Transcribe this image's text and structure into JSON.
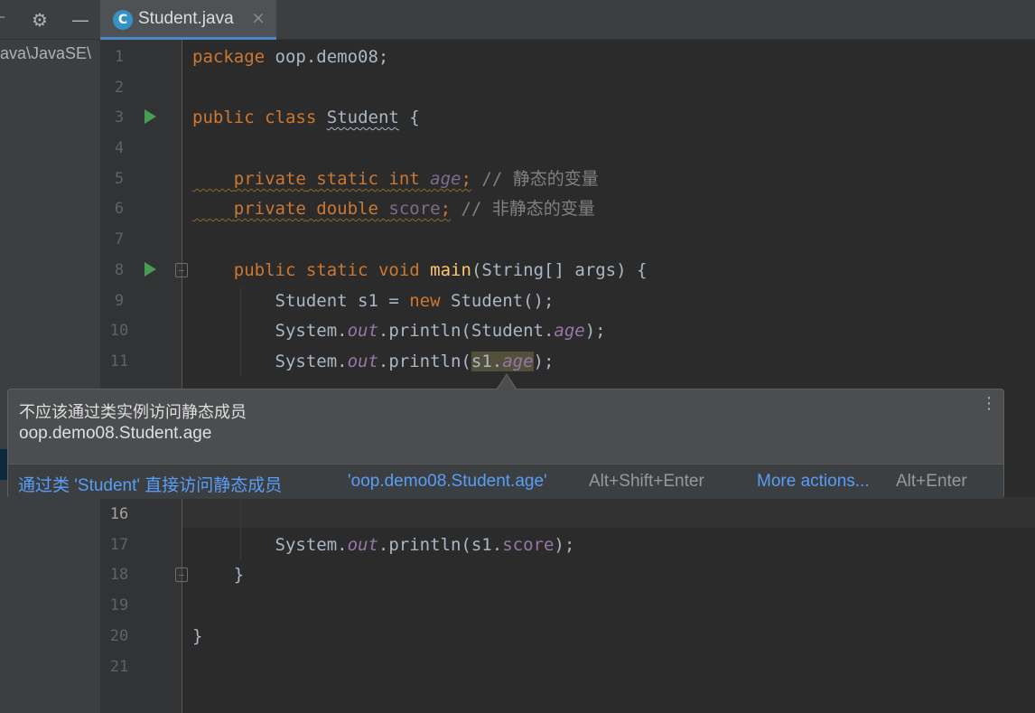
{
  "project": {
    "path_fragment": "ava\\JavaSE\\"
  },
  "toolbar": {
    "settings_icon": "gear-icon",
    "collapse_icon": "minus-icon"
  },
  "tab": {
    "icon_letter": "C",
    "label": "Student.java",
    "close": "×"
  },
  "editor": {
    "current_line": 16,
    "line_numbers": [
      "1",
      "2",
      "3",
      "4",
      "5",
      "6",
      "7",
      "8",
      "9",
      "10",
      "11",
      "16",
      "17",
      "18",
      "19",
      "20",
      "21"
    ],
    "lines": {
      "l1": {
        "kw": "package",
        "rest": " oop.demo08;"
      },
      "l3": {
        "kw1": "public",
        "kw2": "class",
        "name": "Student",
        "rest": " {"
      },
      "l5": {
        "kw1": "private",
        "kw2": "static",
        "kw3": "int",
        "field": "age",
        "semi": ";",
        "comment": " // 静态的变量"
      },
      "l6": {
        "kw1": "private",
        "kw2": "double",
        "field": "score",
        "semi": ";",
        "comment": " // 非静态的变量"
      },
      "l8": {
        "kw1": "public",
        "kw2": "static",
        "kw3": "void",
        "method": "main",
        "rest": "(String[] args) {"
      },
      "l9": {
        "pre": "Student s1 = ",
        "kw": "new",
        "rest": " Student();"
      },
      "l10": {
        "pre": "System.",
        "out": "out",
        "mid": ".println(Student.",
        "field": "age",
        "end": ");"
      },
      "l11": {
        "pre": "System.",
        "out": "out",
        "mid": ".println(",
        "hl1": "s1.",
        "field": "age",
        "end": ");"
      },
      "l17": {
        "pre": "System.",
        "out": "out",
        "mid": ".println(s1.",
        "field": "score",
        "end": ");"
      },
      "l18": {
        "text": "}"
      },
      "l20": {
        "text": "}"
      }
    }
  },
  "popup": {
    "message": "不应该通过类实例访问静态成员",
    "member": "oop.demo08.Student.age",
    "fix_action": "通过类 'Student' 直接访问静态成员",
    "fix_target": "'oop.demo08.Student.age'",
    "fix_shortcut": "Alt+Shift+Enter",
    "more_actions": "More actions...",
    "more_shortcut": "Alt+Enter",
    "menu_icon": "⋮"
  }
}
